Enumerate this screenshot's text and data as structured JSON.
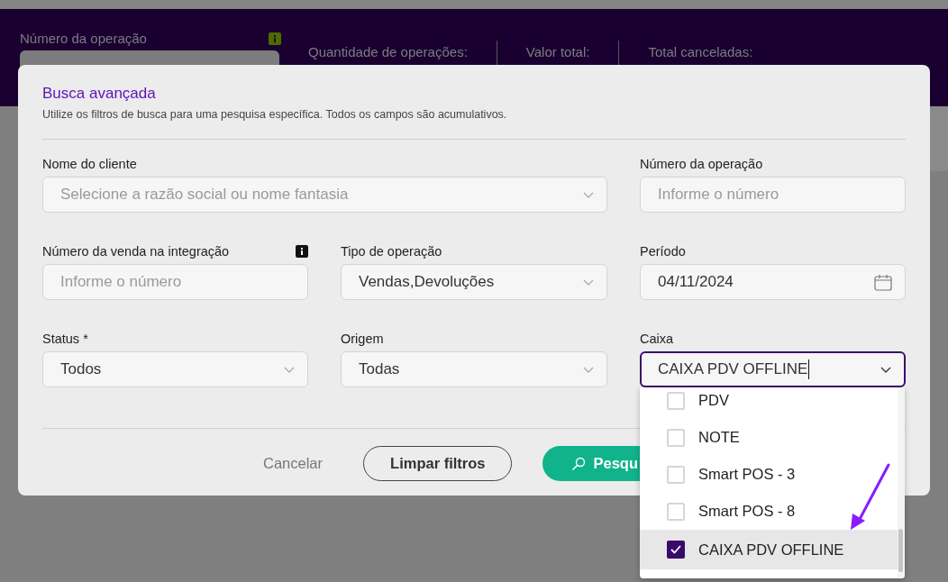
{
  "header": {
    "operation_field": {
      "label": "Número da operação",
      "info": true
    },
    "stats": [
      {
        "label": "Quantidade de operações:"
      },
      {
        "label": "Valor total:"
      },
      {
        "label": "Total canceladas:"
      }
    ]
  },
  "modal": {
    "title": "Busca avançada",
    "subtitle": "Utilize os filtros de busca para uma pesquisa específica. Todos os campos são acumulativos.",
    "fields": [
      {
        "label": "Nome do cliente",
        "kind": "select",
        "placeholder": "Selecione a razão social ou nome fantasia",
        "wide": true
      },
      {
        "label": "Número da operação",
        "kind": "input",
        "placeholder": "Informe o número"
      },
      {
        "label": "Número da venda na integração",
        "kind": "input",
        "placeholder": "Informe o número",
        "info": true
      },
      {
        "label": "Tipo de operação",
        "kind": "select",
        "value": "Vendas,Devoluções"
      },
      {
        "label": "Período",
        "kind": "date",
        "value": "04/11/2024"
      },
      {
        "label": "Status *",
        "kind": "select",
        "value": "Todos"
      },
      {
        "label": "Origem",
        "kind": "select",
        "value": "Todas"
      },
      {
        "label": "Caixa",
        "kind": "select",
        "value": "CAIXA PDV OFFLINE",
        "focused": true,
        "open": true
      }
    ],
    "dropdown": {
      "options": [
        {
          "label": "PDV",
          "checked": false,
          "selected": false
        },
        {
          "label": "NOTE",
          "checked": false,
          "selected": false
        },
        {
          "label": "Smart POS - 3",
          "checked": false,
          "selected": false
        },
        {
          "label": "Smart POS - 8",
          "checked": false,
          "selected": false
        },
        {
          "label": "CAIXA PDV OFFLINE",
          "checked": true,
          "selected": true
        }
      ]
    },
    "buttons": [
      {
        "label": "Cancelar",
        "kind": "text"
      },
      {
        "label": "Limpar filtros",
        "kind": "outline"
      },
      {
        "label": "Pesqu",
        "kind": "primary"
      }
    ]
  }
}
